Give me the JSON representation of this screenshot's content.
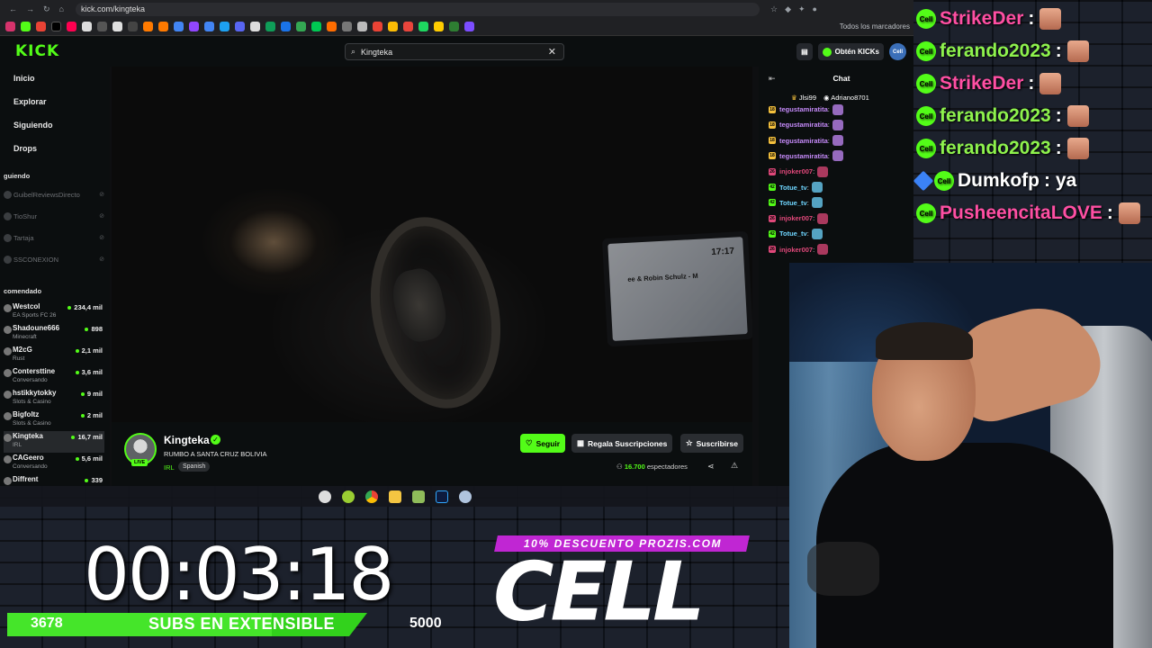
{
  "browser": {
    "url": "kick.com/kingteka",
    "bookmarks_folder": "Todos los marcadores"
  },
  "kick": {
    "logo": "KICK",
    "search_value": "Kingteka",
    "get_kicks": "Obtén KICKs",
    "avatar_text": "Cell"
  },
  "sidebar": {
    "nav": [
      "Inicio",
      "Explorar",
      "Siguiendo",
      "Drops"
    ],
    "following_heading": "guiendo",
    "following": [
      "GuibelReviewsDirecto",
      "TioShur",
      "Tartaja",
      "SSCONEXION"
    ],
    "recommended_heading": "comendado",
    "recommended": [
      {
        "name": "Westcol",
        "category": "EA Sports FC 26",
        "viewers": "234,4 mil"
      },
      {
        "name": "Shadoune666",
        "category": "Minecraft",
        "viewers": "898"
      },
      {
        "name": "M2cG",
        "category": "Rust",
        "viewers": "2,1 mil"
      },
      {
        "name": "Contersttine",
        "category": "Conversando",
        "viewers": "3,6 mil"
      },
      {
        "name": "hstikkytokky",
        "category": "Slots & Casino",
        "viewers": "9 mil"
      },
      {
        "name": "Bigfoltz",
        "category": "Slots & Casino",
        "viewers": "2 mil"
      },
      {
        "name": "Kingteka",
        "category": "IRL",
        "viewers": "16,7 mil"
      },
      {
        "name": "CAGeero",
        "category": "Conversando",
        "viewers": "5,6 mil"
      },
      {
        "name": "Diffrent",
        "category": "",
        "viewers": "339"
      }
    ]
  },
  "video": {
    "screen_clock": "17:17",
    "screen_track": "ee & Robin Schulz - M"
  },
  "channel": {
    "name": "Kingteka",
    "live": "LIVE",
    "title": "RUMBO A SANTA CRUZ BOLIVIA",
    "category": "IRL",
    "language": "Spanish",
    "follow": "Seguir",
    "gift": "Regala Suscripciones",
    "subscribe": "Suscribirse",
    "viewers_count": "16.700",
    "viewers_label": "espectadores"
  },
  "chat": {
    "title": "Chat",
    "pinned": [
      "Jlsi99",
      "Adriano8701"
    ],
    "messages": [
      {
        "user": "tegustamiratita",
        "badge": "18",
        "color": "#c58af9"
      },
      {
        "user": "tegustamiratita",
        "badge": "18",
        "color": "#c58af9"
      },
      {
        "user": "tegustamiratita",
        "badge": "18",
        "color": "#c58af9"
      },
      {
        "user": "tegustamiratita",
        "badge": "18",
        "color": "#c58af9"
      },
      {
        "user": "injoker007",
        "badge": "26",
        "color": "#e0487a"
      },
      {
        "user": "Totue_tv",
        "badge": "42",
        "color": "#6fd6ff"
      },
      {
        "user": "Totue_tv",
        "badge": "42",
        "color": "#6fd6ff"
      },
      {
        "user": "injoker007",
        "badge": "26",
        "color": "#e0487a"
      },
      {
        "user": "Totue_tv",
        "badge": "42",
        "color": "#6fd6ff"
      },
      {
        "user": "injoker007",
        "badge": "26",
        "color": "#e0487a"
      }
    ]
  },
  "overlay_chat": [
    {
      "user": "StrikeDer",
      "text": ":",
      "color": "#ff4fa3"
    },
    {
      "user": "ferando2023",
      "text": ":",
      "color": "#8ef24d"
    },
    {
      "user": "StrikeDer",
      "text": ":",
      "color": "#ff4fa3"
    },
    {
      "user": "ferando2023",
      "text": ":",
      "color": "#8ef24d"
    },
    {
      "user": "ferando2023",
      "text": ":",
      "color": "#8ef24d"
    },
    {
      "user": "Dumkofp",
      "text": ": ya",
      "color": "#ffffff"
    },
    {
      "user": "PusheencitaLOVE",
      "text": ":",
      "color": "#ff4fa3"
    }
  ],
  "timer": "00:03:18",
  "subathon": {
    "current": "3678",
    "label": "SUBS EN EXTENSIBLE",
    "goal": "5000",
    "progress": 0.7356
  },
  "promo": {
    "banner": "10% DESCUENTO PROZIS.COM",
    "brand": "CELL"
  },
  "colors": {
    "kick_green": "#53fc18",
    "promo_magenta": "#c026d3"
  }
}
